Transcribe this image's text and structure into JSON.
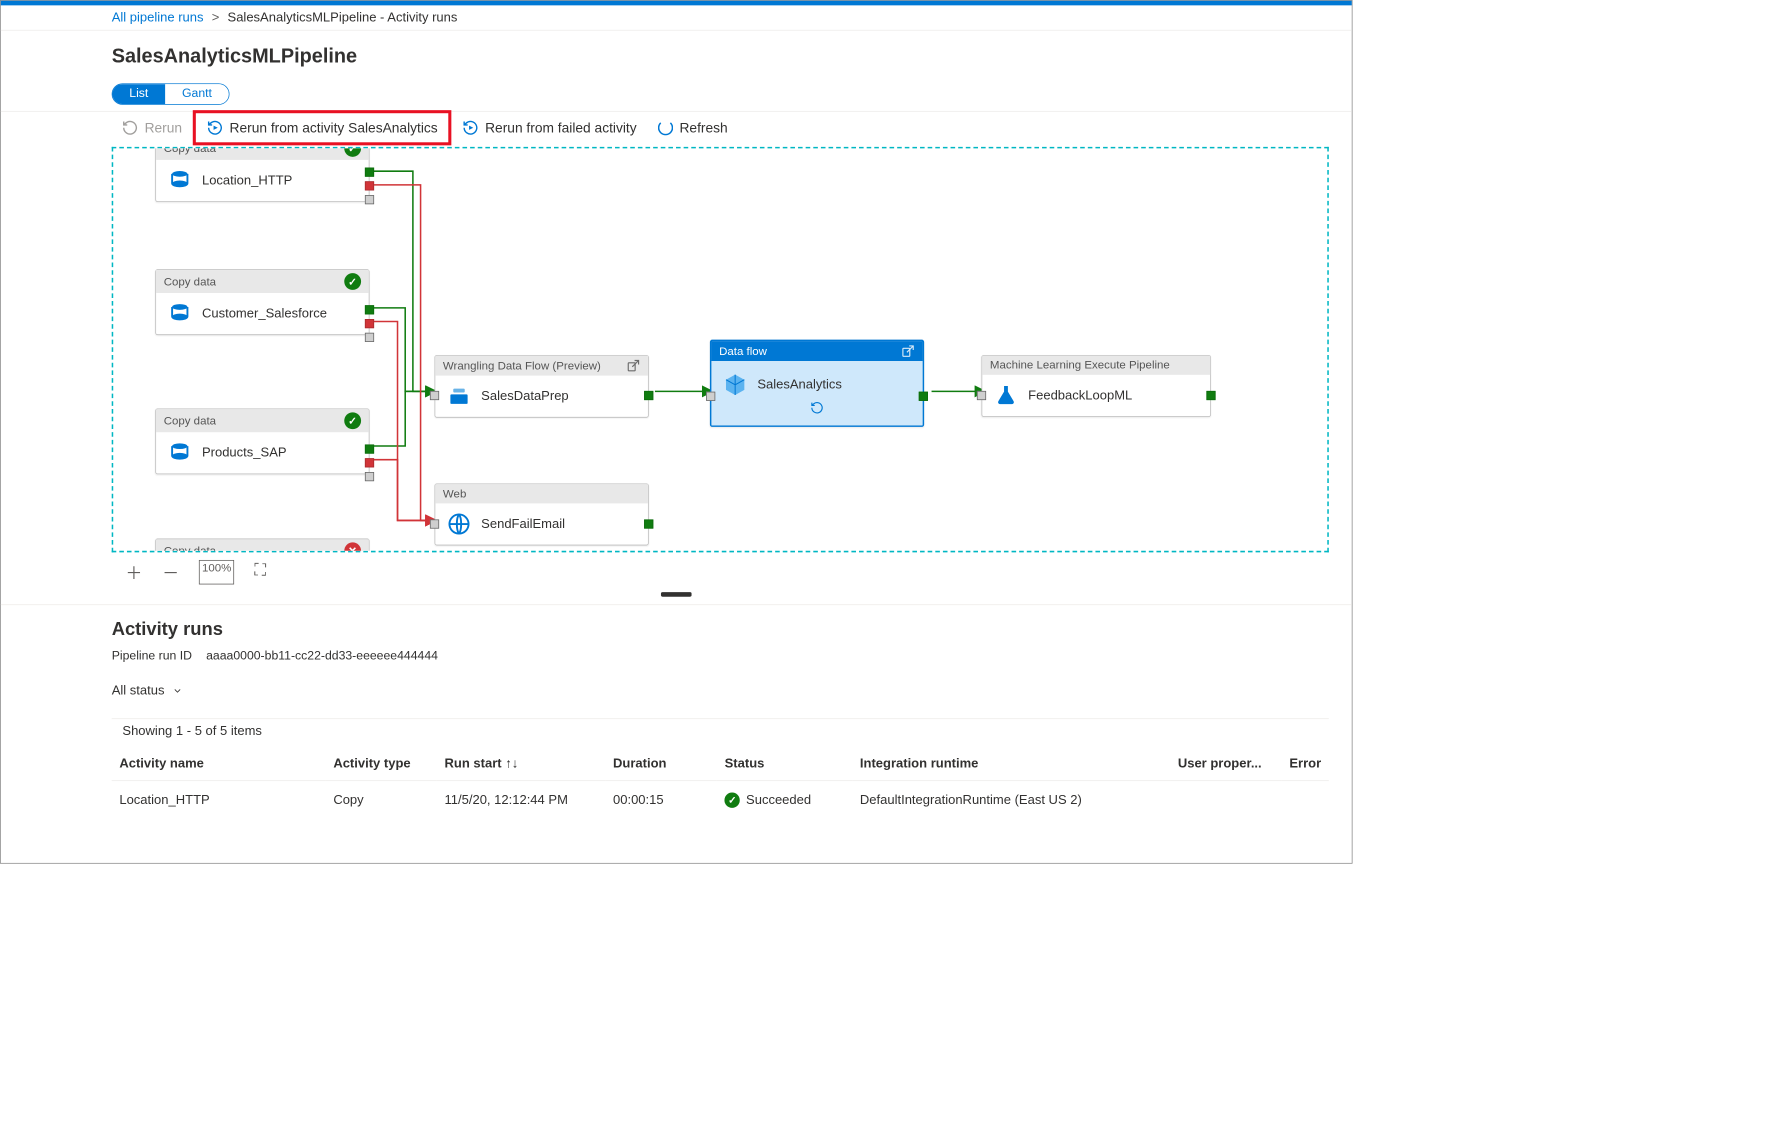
{
  "breadcrumb": {
    "root": "All pipeline runs",
    "current": "SalesAnalyticsMLPipeline - Activity runs"
  },
  "title": "SalesAnalyticsMLPipeline",
  "viewToggle": {
    "list": "List",
    "gantt": "Gantt"
  },
  "toolbar": {
    "rerun": "Rerun",
    "rerun_from_activity": "Rerun from activity SalesAnalytics",
    "rerun_from_failed": "Rerun from failed activity",
    "refresh": "Refresh"
  },
  "nodes": {
    "copydata_label": "Copy data",
    "wrangling_label": "Wrangling Data Flow (Preview)",
    "dataflow_label": "Data flow",
    "ml_label": "Machine Learning Execute Pipeline",
    "web_label": "Web",
    "location_http": "Location_HTTP",
    "customer_salesforce": "Customer_Salesforce",
    "products_sap": "Products_SAP",
    "sales_data_prep": "SalesDataPrep",
    "sales_analytics": "SalesAnalytics",
    "feedback_ml": "FeedbackLoopML",
    "send_fail": "SendFailEmail"
  },
  "runs": {
    "heading": "Activity runs",
    "run_id_label": "Pipeline run ID",
    "run_id": "aaaa0000-bb11-cc22-dd33-eeeeee444444",
    "filter": "All status",
    "count": "Showing 1 - 5 of 5 items",
    "columns": {
      "name": "Activity name",
      "type": "Activity type",
      "start": "Run start",
      "duration": "Duration",
      "status": "Status",
      "runtime": "Integration runtime",
      "userprops": "User proper...",
      "error": "Error"
    },
    "rows": [
      {
        "name": "Location_HTTP",
        "type": "Copy",
        "start": "11/5/20, 12:12:44 PM",
        "duration": "00:00:15",
        "status": "Succeeded",
        "runtime": "DefaultIntegrationRuntime (East US 2)"
      }
    ]
  }
}
